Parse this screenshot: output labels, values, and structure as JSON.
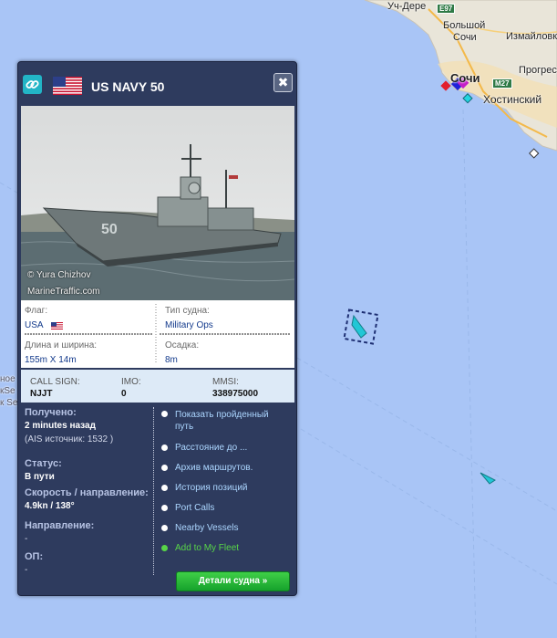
{
  "map": {
    "places": [
      {
        "id": "uch-dere",
        "label": "Уч-Дере"
      },
      {
        "id": "bolshoy",
        "label": "Большой"
      },
      {
        "id": "sochi-small",
        "label": "Сочи"
      },
      {
        "id": "izmailovka",
        "label": "Измайловк"
      },
      {
        "id": "sochi",
        "label": "Сочи"
      },
      {
        "id": "progress",
        "label": "Прогресс"
      },
      {
        "id": "khostinsky",
        "label": "Хостинский"
      }
    ],
    "road_badges": [
      "E97",
      "M27"
    ],
    "edge_texts": [
      "ное",
      "кSe",
      "к Se"
    ],
    "colors": {
      "sea": "#a9c5f6",
      "land": "#e8e4d8",
      "vessel": "#21c7d6",
      "route": "#7fa6df"
    }
  },
  "popup": {
    "title": "US NAVY 50",
    "flag_icon": "us-flag",
    "photo_credits": [
      "© Yura Chizhov",
      "MarineTraffic.com"
    ],
    "hull_number": "50",
    "info": {
      "flag_label": "Флаг:",
      "flag_value": "USA",
      "type_label": "Тип судна:",
      "type_value": "Military Ops",
      "size_label": "Длина и ширина:",
      "size_value": "155m X 14m",
      "draft_label": "Осадка:",
      "draft_value": "8m"
    },
    "ids": {
      "callsign_label": "CALL SIGN:",
      "callsign_value": "NJJT",
      "imo_label": "IMO:",
      "imo_value": "0",
      "mmsi_label": "MMSI:",
      "mmsi_value": "338975000"
    },
    "status": {
      "received_label": "Получено:",
      "received_value": "2 minutes назад",
      "ais_source": "(AIS источник: 1532 )",
      "status_label": "Статус:",
      "status_value": "В пути",
      "speed_label": "Скорость / направление:",
      "speed_value": "4.9kn / 138°",
      "direction_label": "Направление:",
      "direction_value": "-",
      "op_label": "ОП:",
      "op_value": "-"
    },
    "links": [
      "Показать пройденный путь",
      "Расстояние до ...",
      "Архив маршрутов.",
      "История позиций",
      "Port Calls",
      "Nearby Vessels",
      "Add to My Fleet"
    ],
    "details_button": "Детали судна »",
    "close_label": "✖"
  }
}
